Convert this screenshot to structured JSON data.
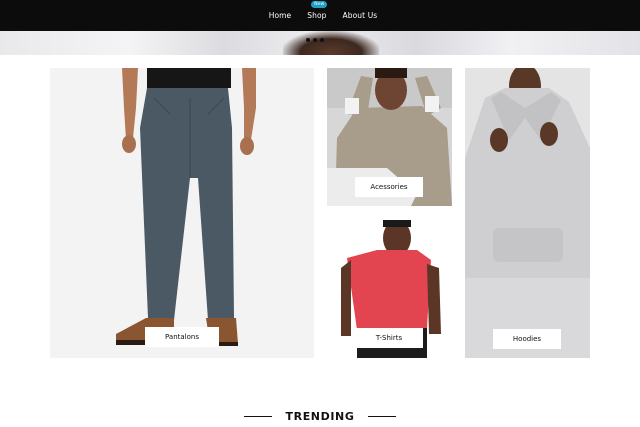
{
  "nav": {
    "items": [
      {
        "label": "Home"
      },
      {
        "label": "Shop",
        "badge": "New"
      },
      {
        "label": "About Us"
      }
    ]
  },
  "categories": {
    "pants": {
      "label": "Pantalons"
    },
    "accessories": {
      "label": "Acessories"
    },
    "tshirts": {
      "label": "T-Shirts"
    },
    "hoodies": {
      "label": "Hoodies"
    }
  },
  "trending": {
    "title": "TRENDING"
  },
  "colors": {
    "nav_bg": "#0c0c0c",
    "badge": "#1fa0c8",
    "pants": "#4a5964",
    "tshirt": "#e2454f"
  }
}
